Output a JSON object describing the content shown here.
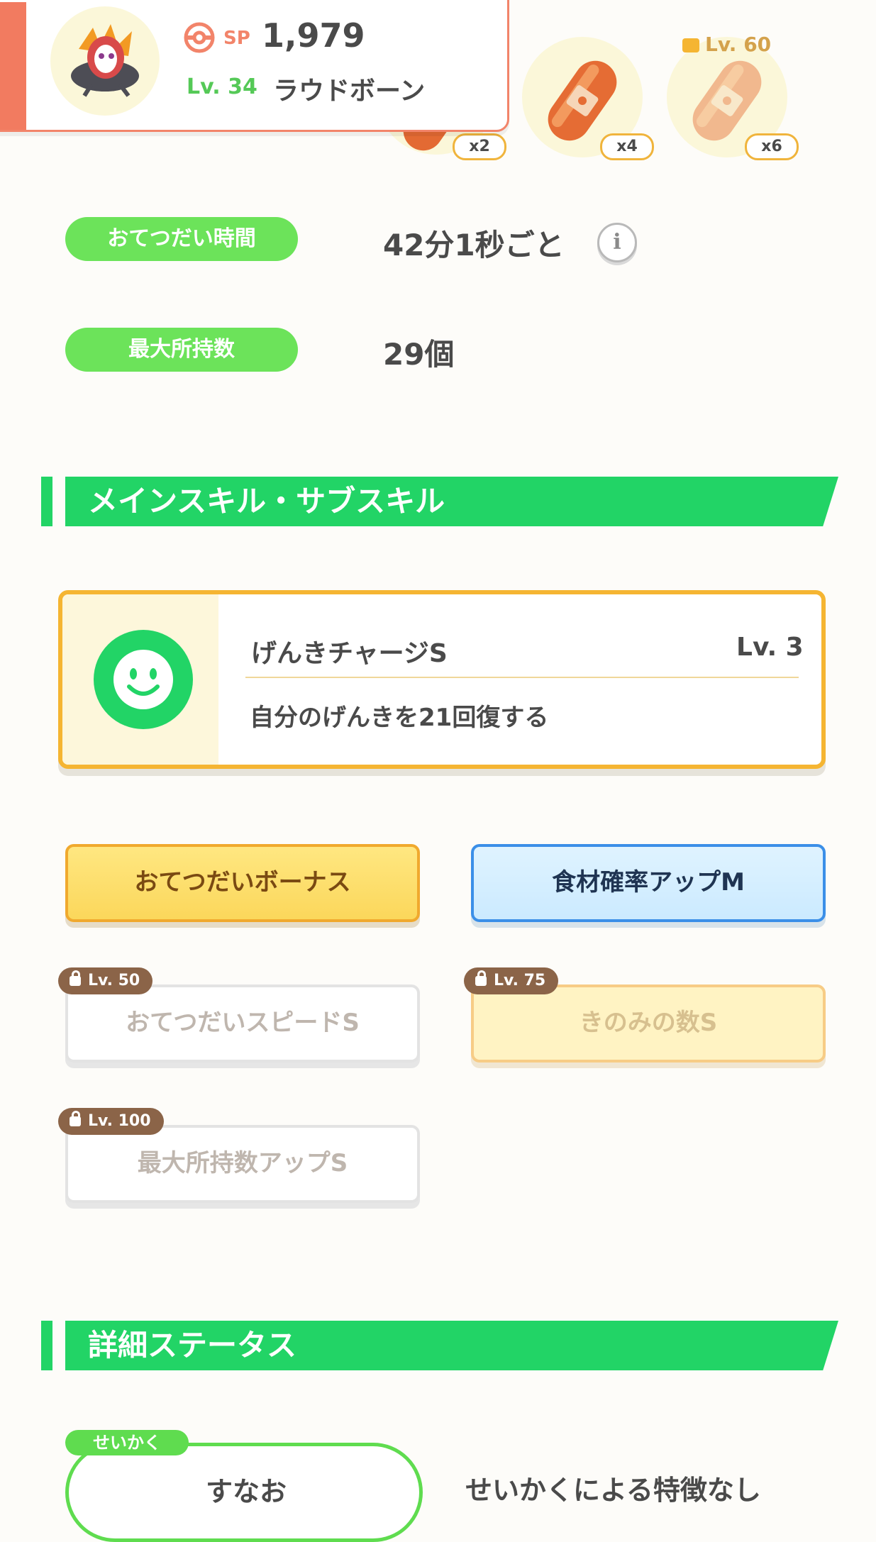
{
  "header": {
    "sp_label": "SP",
    "sp_value": "1,979",
    "level": "Lv. 34",
    "pokemon_name": "ラウドボーン",
    "sp_icon": "pokeball-icon"
  },
  "ingredients": [
    {
      "qty": "x2"
    },
    {
      "qty": "x4"
    },
    {
      "qty": "x6",
      "locked": true,
      "unlock_level": "Lv. 60"
    }
  ],
  "stats": {
    "help_time_label": "おてつだい時間",
    "help_time_value": "42分1秒ごと",
    "max_carry_label": "最大所持数",
    "max_carry_value": "29個",
    "info_icon_glyph": "i"
  },
  "skills_section": {
    "title": "メインスキル・サブスキル",
    "main_skill": {
      "name": "げんきチャージS",
      "level": "Lv. 3",
      "description": "自分のげんきを21回復する",
      "icon": "smile-icon"
    },
    "sub_skills": [
      {
        "label": "おてつだいボーナス",
        "unlocked": true
      },
      {
        "label": "食材確率アップM",
        "unlocked": true
      },
      {
        "label": "おてつだいスピードS",
        "lock_level": "Lv. 50"
      },
      {
        "label": "きのみの数S",
        "lock_level": "Lv. 75"
      },
      {
        "label": "最大所持数アップS",
        "lock_level": "Lv. 100"
      }
    ]
  },
  "details_section": {
    "title": "詳細ステータス",
    "nature_label": "せいかく",
    "nature_value": "すなお",
    "nature_effect": "せいかくによる特徴なし"
  },
  "colors": {
    "accent_green": "#22d466",
    "pill_green": "#6ce35a",
    "gold": "#f5b532",
    "header_red": "#f27b60"
  }
}
